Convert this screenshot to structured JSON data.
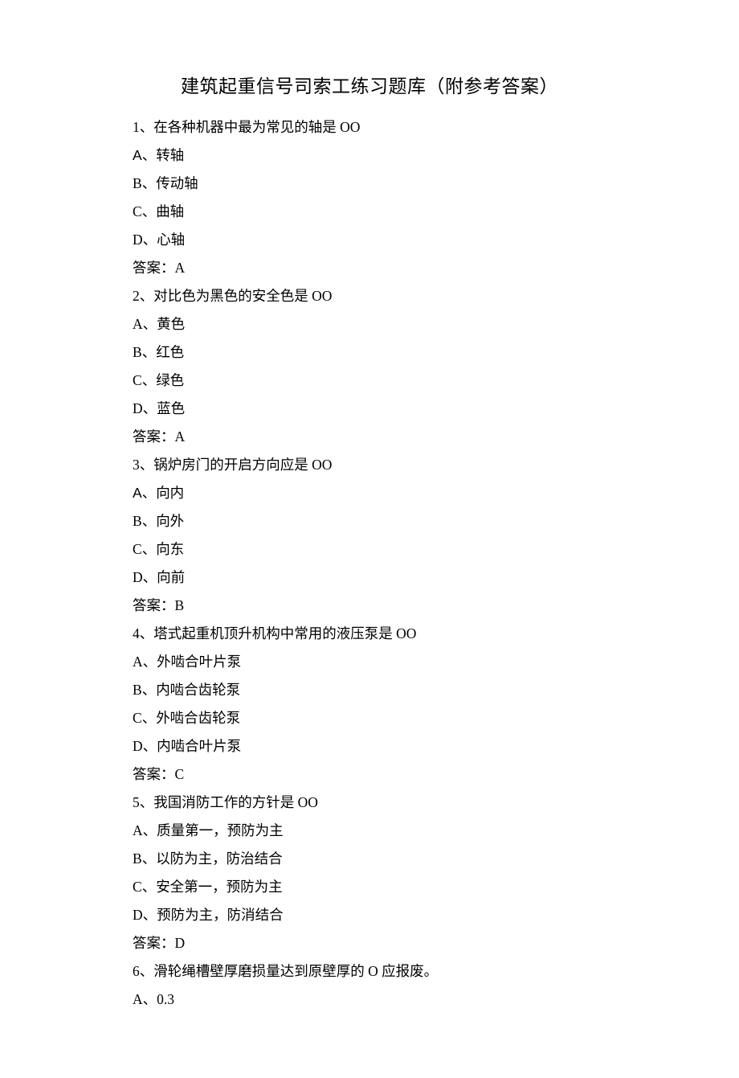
{
  "title": "建筑起重信号司索工练习题库（附参考答案）",
  "answer_label": "答案：",
  "questions": [
    {
      "number": "1",
      "stem": "在各种机器中最为常见的轴是 OO",
      "options": [
        {
          "letter": "A",
          "text": "转轴",
          "letter_sans": true
        },
        {
          "letter": "B",
          "text": "传动轴"
        },
        {
          "letter": "C",
          "text": "曲轴"
        },
        {
          "letter": "D",
          "text": "心轴"
        }
      ],
      "answer": "A"
    },
    {
      "number": "2",
      "stem": "对比色为黑色的安全色是 OO",
      "options": [
        {
          "letter": "A",
          "text": "黄色"
        },
        {
          "letter": "B",
          "text": "红色"
        },
        {
          "letter": "C",
          "text": "绿色"
        },
        {
          "letter": "D",
          "text": "蓝色"
        }
      ],
      "answer": "A"
    },
    {
      "number": "3",
      "stem": "锅炉房门的开启方向应是 OO",
      "options": [
        {
          "letter": "A",
          "text": "向内",
          "letter_sans": true
        },
        {
          "letter": "B",
          "text": "向外"
        },
        {
          "letter": "C",
          "text": "向东"
        },
        {
          "letter": "D",
          "text": "向前"
        }
      ],
      "answer": "B"
    },
    {
      "number": "4",
      "stem": "塔式起重机顶升机构中常用的液压泵是 OO",
      "options": [
        {
          "letter": "A",
          "text": "外啮合叶片泵"
        },
        {
          "letter": "B",
          "text": "内啮合齿轮泵"
        },
        {
          "letter": "C",
          "text": "外啮合齿轮泵"
        },
        {
          "letter": "D",
          "text": "内啮合叶片泵"
        }
      ],
      "answer": "C"
    },
    {
      "number": "5",
      "stem": "我国消防工作的方针是 OO",
      "options": [
        {
          "letter": "A",
          "text": "质量第一，预防为主"
        },
        {
          "letter": "B",
          "text": "以防为主，防治结合"
        },
        {
          "letter": "C",
          "text": "安全第一，预防为主"
        },
        {
          "letter": "D",
          "text": "预防为主，防消结合"
        }
      ],
      "answer": "D"
    },
    {
      "number": "6",
      "stem": "滑轮绳槽壁厚磨损量达到原壁厚的 O 应报废。",
      "options": [
        {
          "letter": "A",
          "text": "0.3"
        }
      ]
    }
  ]
}
